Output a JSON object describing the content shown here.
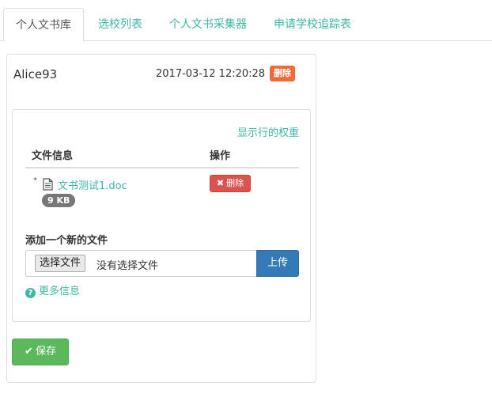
{
  "tabs": [
    {
      "label": "个人文书库",
      "active": true
    },
    {
      "label": "选校列表",
      "active": false
    },
    {
      "label": "个人文书采集器",
      "active": false
    },
    {
      "label": "申请学校追踪表",
      "active": false
    }
  ],
  "record": {
    "username": "Alice93",
    "datetime": "2017-03-12 12:20:28",
    "delete_badge": "删除"
  },
  "files_panel": {
    "show_weights_link": "显示行的权重",
    "columns": {
      "file_info": "文件信息",
      "actions": "操作"
    },
    "rows": [
      {
        "bullet": "*",
        "file_name": "文书测试1.doc",
        "size": "9 KB",
        "delete_label": "删除",
        "icon": "document-icon"
      }
    ],
    "add_label": "添加一个新的文件",
    "choose_file_label": "选择文件",
    "no_file_text": "没有选择文件",
    "upload_label": "上传",
    "more_info_label": "更多信息"
  },
  "save_label": "保存",
  "colors": {
    "link": "#3fb7a5",
    "danger": "#d9534f",
    "warning_badge": "#ef6b3a",
    "primary": "#337ab7",
    "success": "#5cb85c"
  }
}
